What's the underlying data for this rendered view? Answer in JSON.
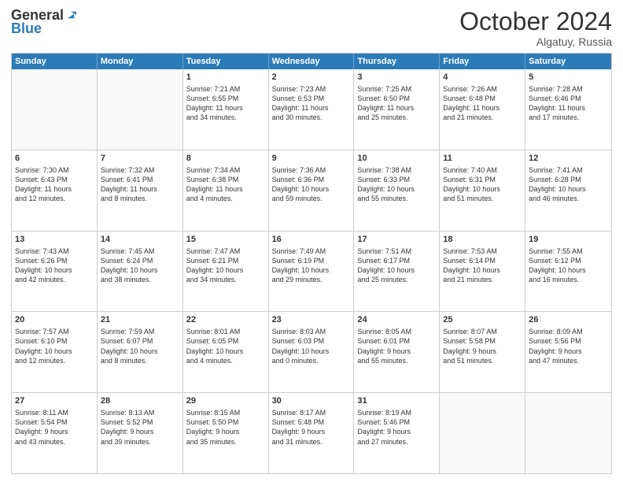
{
  "header": {
    "logo_general": "General",
    "logo_blue": "Blue",
    "month_title": "October 2024",
    "location": "Algatuy, Russia"
  },
  "days_of_week": [
    "Sunday",
    "Monday",
    "Tuesday",
    "Wednesday",
    "Thursday",
    "Friday",
    "Saturday"
  ],
  "weeks": [
    [
      {
        "day": "",
        "empty": true
      },
      {
        "day": "",
        "empty": true
      },
      {
        "day": "1",
        "lines": [
          "Sunrise: 7:21 AM",
          "Sunset: 6:55 PM",
          "Daylight: 11 hours",
          "and 34 minutes."
        ]
      },
      {
        "day": "2",
        "lines": [
          "Sunrise: 7:23 AM",
          "Sunset: 6:53 PM",
          "Daylight: 11 hours",
          "and 30 minutes."
        ]
      },
      {
        "day": "3",
        "lines": [
          "Sunrise: 7:25 AM",
          "Sunset: 6:50 PM",
          "Daylight: 11 hours",
          "and 25 minutes."
        ]
      },
      {
        "day": "4",
        "lines": [
          "Sunrise: 7:26 AM",
          "Sunset: 6:48 PM",
          "Daylight: 11 hours",
          "and 21 minutes."
        ]
      },
      {
        "day": "5",
        "lines": [
          "Sunrise: 7:28 AM",
          "Sunset: 6:46 PM",
          "Daylight: 11 hours",
          "and 17 minutes."
        ]
      }
    ],
    [
      {
        "day": "6",
        "lines": [
          "Sunrise: 7:30 AM",
          "Sunset: 6:43 PM",
          "Daylight: 11 hours",
          "and 12 minutes."
        ]
      },
      {
        "day": "7",
        "lines": [
          "Sunrise: 7:32 AM",
          "Sunset: 6:41 PM",
          "Daylight: 11 hours",
          "and 8 minutes."
        ]
      },
      {
        "day": "8",
        "lines": [
          "Sunrise: 7:34 AM",
          "Sunset: 6:38 PM",
          "Daylight: 11 hours",
          "and 4 minutes."
        ]
      },
      {
        "day": "9",
        "lines": [
          "Sunrise: 7:36 AM",
          "Sunset: 6:36 PM",
          "Daylight: 10 hours",
          "and 59 minutes."
        ]
      },
      {
        "day": "10",
        "lines": [
          "Sunrise: 7:38 AM",
          "Sunset: 6:33 PM",
          "Daylight: 10 hours",
          "and 55 minutes."
        ]
      },
      {
        "day": "11",
        "lines": [
          "Sunrise: 7:40 AM",
          "Sunset: 6:31 PM",
          "Daylight: 10 hours",
          "and 51 minutes."
        ]
      },
      {
        "day": "12",
        "lines": [
          "Sunrise: 7:41 AM",
          "Sunset: 6:28 PM",
          "Daylight: 10 hours",
          "and 46 minutes."
        ]
      }
    ],
    [
      {
        "day": "13",
        "lines": [
          "Sunrise: 7:43 AM",
          "Sunset: 6:26 PM",
          "Daylight: 10 hours",
          "and 42 minutes."
        ]
      },
      {
        "day": "14",
        "lines": [
          "Sunrise: 7:45 AM",
          "Sunset: 6:24 PM",
          "Daylight: 10 hours",
          "and 38 minutes."
        ]
      },
      {
        "day": "15",
        "lines": [
          "Sunrise: 7:47 AM",
          "Sunset: 6:21 PM",
          "Daylight: 10 hours",
          "and 34 minutes."
        ]
      },
      {
        "day": "16",
        "lines": [
          "Sunrise: 7:49 AM",
          "Sunset: 6:19 PM",
          "Daylight: 10 hours",
          "and 29 minutes."
        ]
      },
      {
        "day": "17",
        "lines": [
          "Sunrise: 7:51 AM",
          "Sunset: 6:17 PM",
          "Daylight: 10 hours",
          "and 25 minutes."
        ]
      },
      {
        "day": "18",
        "lines": [
          "Sunrise: 7:53 AM",
          "Sunset: 6:14 PM",
          "Daylight: 10 hours",
          "and 21 minutes."
        ]
      },
      {
        "day": "19",
        "lines": [
          "Sunrise: 7:55 AM",
          "Sunset: 6:12 PM",
          "Daylight: 10 hours",
          "and 16 minutes."
        ]
      }
    ],
    [
      {
        "day": "20",
        "lines": [
          "Sunrise: 7:57 AM",
          "Sunset: 6:10 PM",
          "Daylight: 10 hours",
          "and 12 minutes."
        ]
      },
      {
        "day": "21",
        "lines": [
          "Sunrise: 7:59 AM",
          "Sunset: 6:07 PM",
          "Daylight: 10 hours",
          "and 8 minutes."
        ]
      },
      {
        "day": "22",
        "lines": [
          "Sunrise: 8:01 AM",
          "Sunset: 6:05 PM",
          "Daylight: 10 hours",
          "and 4 minutes."
        ]
      },
      {
        "day": "23",
        "lines": [
          "Sunrise: 8:03 AM",
          "Sunset: 6:03 PM",
          "Daylight: 10 hours",
          "and 0 minutes."
        ]
      },
      {
        "day": "24",
        "lines": [
          "Sunrise: 8:05 AM",
          "Sunset: 6:01 PM",
          "Daylight: 9 hours",
          "and 55 minutes."
        ]
      },
      {
        "day": "25",
        "lines": [
          "Sunrise: 8:07 AM",
          "Sunset: 5:58 PM",
          "Daylight: 9 hours",
          "and 51 minutes."
        ]
      },
      {
        "day": "26",
        "lines": [
          "Sunrise: 8:09 AM",
          "Sunset: 5:56 PM",
          "Daylight: 9 hours",
          "and 47 minutes."
        ]
      }
    ],
    [
      {
        "day": "27",
        "lines": [
          "Sunrise: 8:11 AM",
          "Sunset: 5:54 PM",
          "Daylight: 9 hours",
          "and 43 minutes."
        ]
      },
      {
        "day": "28",
        "lines": [
          "Sunrise: 8:13 AM",
          "Sunset: 5:52 PM",
          "Daylight: 9 hours",
          "and 39 minutes."
        ]
      },
      {
        "day": "29",
        "lines": [
          "Sunrise: 8:15 AM",
          "Sunset: 5:50 PM",
          "Daylight: 9 hours",
          "and 35 minutes."
        ]
      },
      {
        "day": "30",
        "lines": [
          "Sunrise: 8:17 AM",
          "Sunset: 5:48 PM",
          "Daylight: 9 hours",
          "and 31 minutes."
        ]
      },
      {
        "day": "31",
        "lines": [
          "Sunrise: 8:19 AM",
          "Sunset: 5:46 PM",
          "Daylight: 9 hours",
          "and 27 minutes."
        ]
      },
      {
        "day": "",
        "empty": true
      },
      {
        "day": "",
        "empty": true
      }
    ]
  ]
}
